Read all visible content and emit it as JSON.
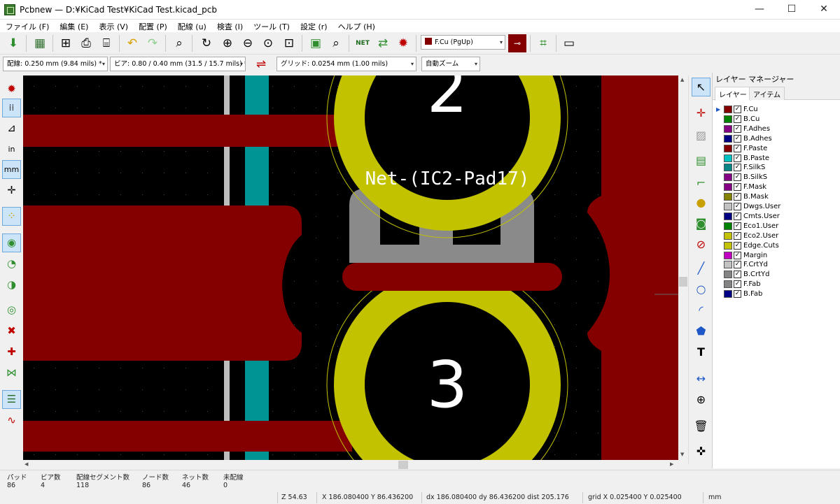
{
  "window": {
    "title": "Pcbnew — D:¥KiCad Test¥KiCad Test.kicad_pcb",
    "minimize": "—",
    "maximize": "☐",
    "close": "✕"
  },
  "menu": [
    {
      "label": "ファイル (F)"
    },
    {
      "label": "編集 (E)"
    },
    {
      "label": "表示 (V)"
    },
    {
      "label": "配置 (P)"
    },
    {
      "label": "配線 (u)"
    },
    {
      "label": "検査 (I)"
    },
    {
      "label": "ツール (T)"
    },
    {
      "label": "設定 (r)"
    },
    {
      "label": "ヘルプ (H)"
    }
  ],
  "toolbar": {
    "active_layer": "F.Cu (PgUp)",
    "active_layer_color": "#840000"
  },
  "toolbar2": {
    "track_width": "配線: 0.250 mm (9.84 mils) *",
    "via_size": "ビア: 0.80 / 0.40 mm (31.5 / 15.7 mils) *",
    "grid": "グリッド: 0.0254 mm (1.00 mils)",
    "zoom": "自動ズーム"
  },
  "left_toolbar": {
    "units_in": "in",
    "units_mm": "mm"
  },
  "canvas": {
    "net_label": "Net-(IC2-Pad17)",
    "pad_number_top": "2",
    "pad_number_bottom": "3",
    "colors": {
      "copper": "#840000",
      "pad": "#c2c200",
      "silk": "#009494",
      "background": "#000000",
      "courtyard": "#8c8c8c"
    }
  },
  "layer_manager": {
    "title": "レイヤー マネージャー",
    "tabs": [
      "レイヤー",
      "アイテム"
    ],
    "layers": [
      {
        "name": "F.Cu",
        "color": "#840000",
        "checked": true,
        "active": true
      },
      {
        "name": "B.Cu",
        "color": "#008400",
        "checked": true
      },
      {
        "name": "F.Adhes",
        "color": "#840084",
        "checked": true
      },
      {
        "name": "B.Adhes",
        "color": "#000084",
        "checked": true
      },
      {
        "name": "F.Paste",
        "color": "#840000",
        "checked": true
      },
      {
        "name": "B.Paste",
        "color": "#00c2c2",
        "checked": true
      },
      {
        "name": "F.SilkS",
        "color": "#008484",
        "checked": true
      },
      {
        "name": "B.SilkS",
        "color": "#840084",
        "checked": true
      },
      {
        "name": "F.Mask",
        "color": "#840084",
        "checked": true
      },
      {
        "name": "B.Mask",
        "color": "#848400",
        "checked": true
      },
      {
        "name": "Dwgs.User",
        "color": "#c2c2c2",
        "checked": true
      },
      {
        "name": "Cmts.User",
        "color": "#000084",
        "checked": true
      },
      {
        "name": "Eco1.User",
        "color": "#008400",
        "checked": true
      },
      {
        "name": "Eco2.User",
        "color": "#c2c200",
        "checked": true
      },
      {
        "name": "Edge.Cuts",
        "color": "#c2c200",
        "checked": true
      },
      {
        "name": "Margin",
        "color": "#c200c2",
        "checked": true
      },
      {
        "name": "F.CrtYd",
        "color": "#c2c2c2",
        "checked": true
      },
      {
        "name": "B.CrtYd",
        "color": "#848484",
        "checked": true
      },
      {
        "name": "F.Fab",
        "color": "#848484",
        "checked": true
      },
      {
        "name": "B.Fab",
        "color": "#000084",
        "checked": true
      }
    ]
  },
  "status": {
    "headers": [
      "パッド",
      "ビア数",
      "配線セグメント数",
      "ノード数",
      "ネット数",
      "未配線"
    ],
    "values": [
      "86",
      "4",
      "118",
      "86",
      "46",
      "0"
    ],
    "zoom": "Z 54.63",
    "abs_coords": "X 186.080400  Y 86.436200",
    "rel_coords": "dx 186.080400  dy 86.436200  dist 205.176",
    "grid": "grid X 0.025400  Y 0.025400",
    "units": "mm"
  }
}
